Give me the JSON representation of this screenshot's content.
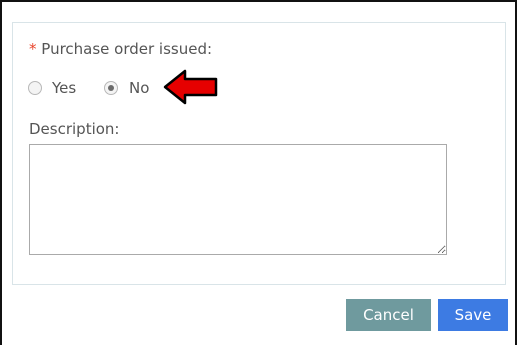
{
  "form": {
    "required_marker": "*",
    "po_label": "Purchase order issued:",
    "options": [
      {
        "label": "Yes",
        "checked": false
      },
      {
        "label": "No",
        "checked": true
      }
    ],
    "description_label": "Description:",
    "description_value": ""
  },
  "buttons": {
    "cancel_label": "Cancel",
    "save_label": "Save"
  },
  "annotation": {
    "icon": "red-left-arrow-icon",
    "color": "#e60000"
  },
  "colors": {
    "required": "#e8452c",
    "cancel_bg": "#6f9a9e",
    "save_bg": "#3d7be3",
    "panel_border": "#d9e4e8"
  }
}
